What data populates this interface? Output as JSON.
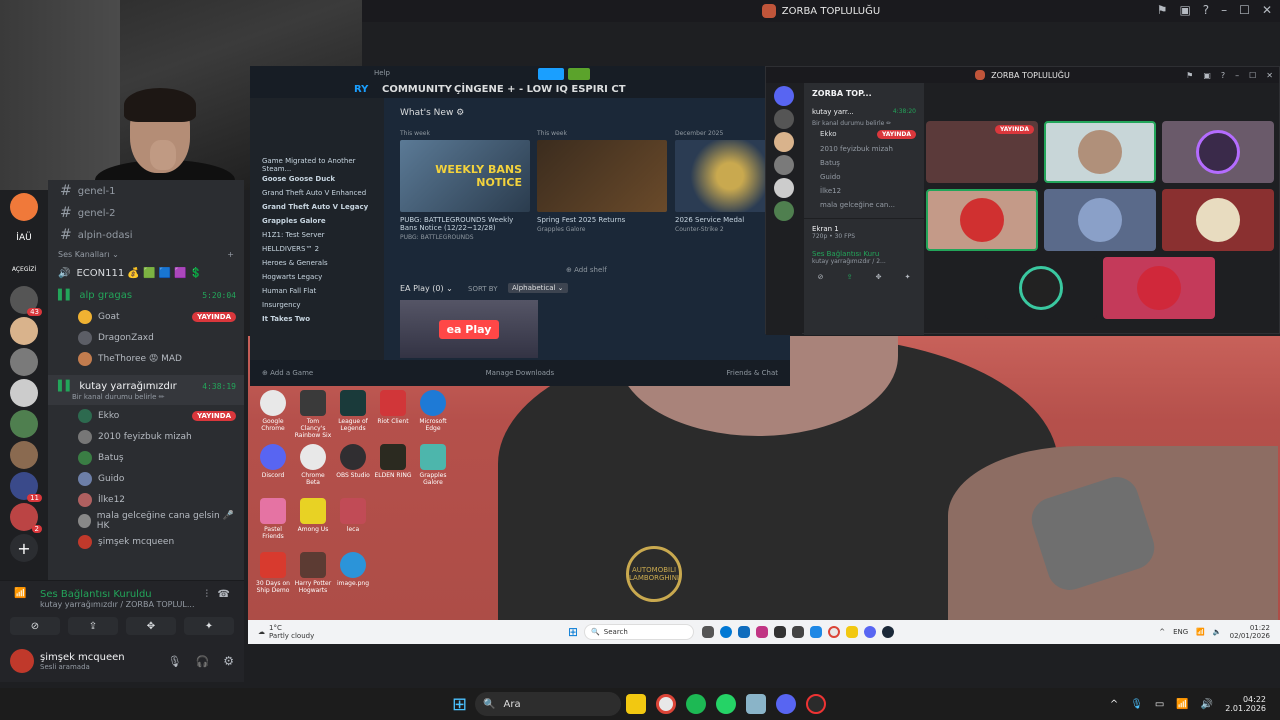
{
  "window": {
    "title": "ZORBA TOPLULUĞU"
  },
  "webcam": {},
  "servers": [
    {
      "label": "İAÜ",
      "badge": ""
    },
    {
      "label": "AÇEGİZİ",
      "badge": ""
    },
    {
      "label": "",
      "badge": "43"
    },
    {
      "label": "",
      "badge": ""
    },
    {
      "label": "",
      "badge": ""
    },
    {
      "label": "",
      "badge": ""
    },
    {
      "label": "",
      "badge": ""
    },
    {
      "label": "",
      "badge": "11"
    },
    {
      "label": "",
      "badge": "2"
    }
  ],
  "channels": {
    "text": [
      {
        "name": "genel-1"
      },
      {
        "name": "genel-2"
      },
      {
        "name": "alpin-odasi"
      }
    ],
    "voice_category": "Ses Kanalları",
    "voice_econ": "ECON111 💰 🟩 🟦 🟪 💲",
    "voice1": {
      "name": "alp gragas",
      "time": "5:20:04"
    },
    "voice1_members": [
      {
        "name": "Goat",
        "live": "YAYINDA",
        "color": "#f0b232"
      },
      {
        "name": "DragonZaxd",
        "live": "",
        "color": "#5c5e66"
      },
      {
        "name": "TheThoree 😡 MAD",
        "live": "",
        "color": "#c27c4e"
      }
    ],
    "voice2": {
      "name": "kutay yarrağımızdır",
      "time": "4:38:19",
      "status": "Bir kanal durumu belirle ✏"
    },
    "voice2_members": [
      {
        "name": "Ekko",
        "live": "YAYINDA",
        "color": "#2d6a4f"
      },
      {
        "name": "2010 feyizbuk mizah",
        "live": "",
        "color": "#777"
      },
      {
        "name": "Batuş",
        "live": "",
        "color": "#3a7d44"
      },
      {
        "name": "Guido",
        "live": "",
        "color": "#6d7fa8"
      },
      {
        "name": "İlke12",
        "live": "",
        "color": "#b06060"
      },
      {
        "name": "mala gelceğine cana gelsin 🎤 HK",
        "live": "",
        "color": "#888"
      },
      {
        "name": "şimşek mcqueen",
        "live": "",
        "color": "#c0392b"
      }
    ]
  },
  "voice_panel": {
    "connected": "Ses Bağlantısı Kuruldu",
    "sub": "kutay yarrağımızdır / ZORBA TOPLUL...",
    "user": "şimşek mcqueen",
    "user_status": "Sesli aramada"
  },
  "steam": {
    "help": "Help",
    "nav": [
      "RY",
      "COMMUNITY",
      "ÇİNGENE + - LOW IQ ESPIRI CT"
    ],
    "whats_new": "What's New ⚙",
    "library": [
      "Game Migrated to Another Steam...",
      "Goose Goose Duck",
      "Grand Theft Auto V Enhanced",
      "Grand Theft Auto V Legacy",
      "Grapples Galore",
      "H1Z1: Test Server",
      "HELLDIVERS™ 2",
      "Heroes & Generals",
      "Hogwarts Legacy",
      "Human Fall Flat",
      "Insurgency",
      "It Takes Two"
    ],
    "cards": [
      {
        "period": "This week",
        "title": "PUBG: BATTLEGROUNDS Weekly Bans Notice (12/22~12/28)",
        "source": "PUBG: BATTLEGROUNDS",
        "img_text": "WEEKLY BANS NOTICE",
        "color": "#5b7a96"
      },
      {
        "period": "This week",
        "title": "Spring Fest 2025 Returns",
        "source": "Grapples Galore",
        "img_text": "",
        "color": "#3b2c1e"
      },
      {
        "period": "December 2025",
        "title": "2026 Service Medal",
        "source": "Counter-Strike 2",
        "img_text": "",
        "color": "#2b3c53"
      }
    ],
    "add_shelf": "⊕ Add shelf",
    "ea_play": "EA Play (0) ⌄",
    "sort_by": "SORT BY",
    "sort_value": "Alphabetical ⌄",
    "ea_logo": "ea Play",
    "add_game": "⊕ Add a Game",
    "downloads": "Manage Downloads",
    "friends": "Friends & Chat"
  },
  "popup": {
    "title": "ZORBA TOPLULUĞU",
    "server": "ZORBA TOP...",
    "channel": "kutay yarr...",
    "channel_time": "4:38:20",
    "channel_status": "Bir kanal durumu belirle ✏",
    "members": [
      "Ekko",
      "2010 feyizbuk mizah",
      "Batuş",
      "Guido",
      "İlke12",
      "mala gelceğine can..."
    ],
    "live": "YAYINDA",
    "screen": "Ekran 1",
    "screen_sub": "720p • 30 FPS",
    "connected": "Ses Bağlantısı Kuru",
    "connected_sub": "kutay yarrağımızdır / 2..."
  },
  "desktop": {
    "logo": "AUTOMOBILI LAMBORGHINI",
    "icons": [
      {
        "label": "Google Chrome",
        "color": "#e8e8e8"
      },
      {
        "label": "Tom Clancy's Rainbow Six",
        "color": "#3a3a3a"
      },
      {
        "label": "League of Legends",
        "color": "#1a3a3a"
      },
      {
        "label": "Riot Client",
        "color": "#d13639"
      },
      {
        "label": "Microsoft Edge",
        "color": "#1e7ad6"
      },
      {
        "label": "Discord",
        "color": "#5865f2"
      },
      {
        "label": "Chrome Beta",
        "color": "#e8e8e8"
      },
      {
        "label": "OBS Studio",
        "color": "#302e31"
      },
      {
        "label": "ELDEN RING",
        "color": "#2b2a20"
      },
      {
        "label": "Grapples Galore",
        "color": "#4db6ac"
      },
      {
        "label": "Pastel Friends",
        "color": "#e573a3"
      },
      {
        "label": "Among Us",
        "color": "#e8d224"
      },
      {
        "label": "leca",
        "color": "#c14b56"
      },
      {
        "label": "30 Days on Ship Demo",
        "color": "#d83a2e"
      },
      {
        "label": "Harry Potter Hogwarts",
        "color": "#5c3b33"
      },
      {
        "label": "image.png",
        "color": "#2b94d9"
      }
    ]
  },
  "inner_taskbar": {
    "weather_temp": "1°C",
    "weather": "Partly cloudy",
    "search": "Search",
    "lang": "ENG",
    "time": "01:22",
    "date": "02/01/2026"
  },
  "taskbar": {
    "search": "Ara",
    "time": "04:22",
    "date": "2.01.2026"
  }
}
